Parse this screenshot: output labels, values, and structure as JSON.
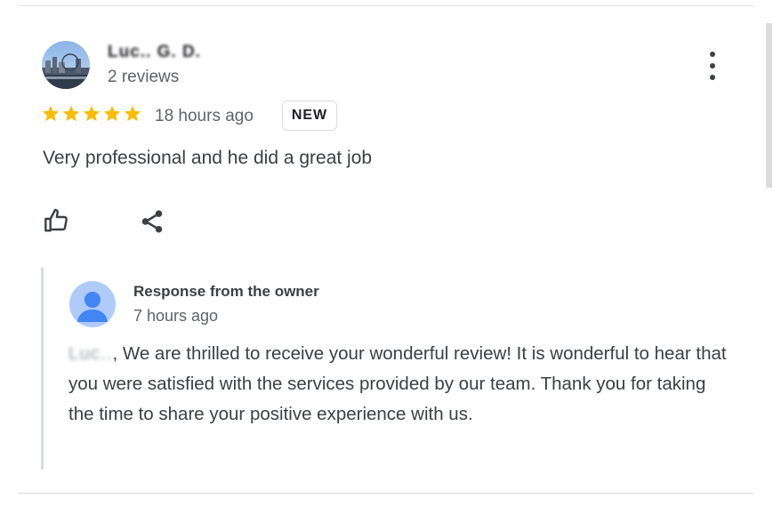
{
  "review": {
    "reviewer_name": "Luc.. G. D.",
    "review_count": "2 reviews",
    "rating": 5,
    "time_ago": "18 hours ago",
    "badge": "NEW",
    "text": "Very professional and he did a great job"
  },
  "owner_response": {
    "title": "Response from the owner",
    "time_ago": "7 hours ago",
    "greeting_name": "Luc..",
    "text": ", We are thrilled to receive your wonderful review! It is wonderful to hear that you were satisfied with the services provided by our team. Thank you for taking the time to share your positive experience with us."
  },
  "icons": {
    "more": "more-vert-icon",
    "like": "thumb-up-icon",
    "share": "share-icon",
    "star": "star-icon"
  },
  "colors": {
    "star": "#fbbc04",
    "owner_avatar_bg": "#aecbfa",
    "owner_avatar_fg": "#4285f4",
    "divider": "#dadce0"
  }
}
